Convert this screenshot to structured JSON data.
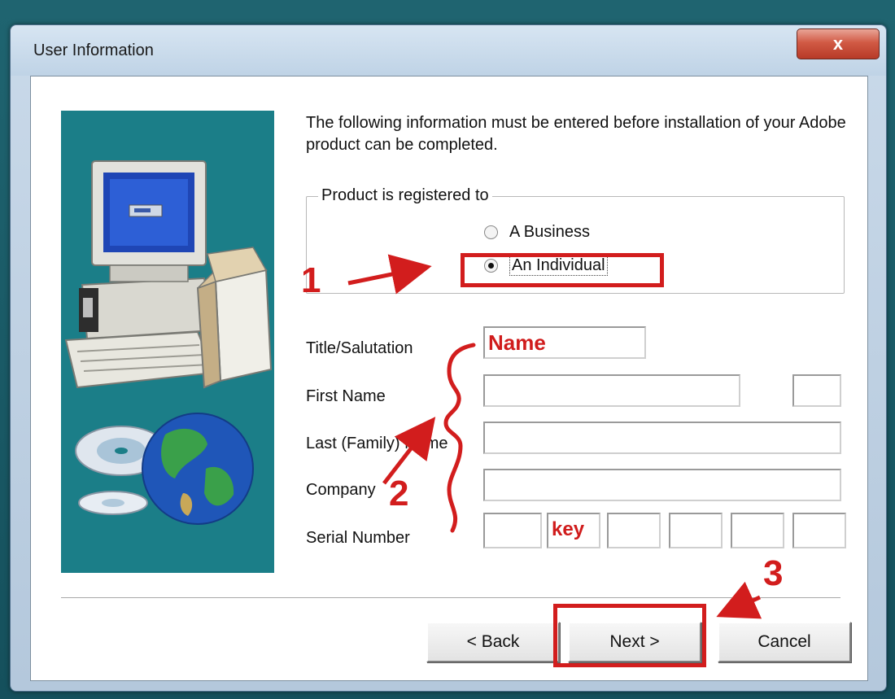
{
  "window": {
    "title": "User Information",
    "close_symbol": "x"
  },
  "intro_text": "The following information must be entered before installation of your Adobe product can be completed.",
  "registration": {
    "legend": "Product is registered to",
    "options": [
      {
        "label": "A Business",
        "selected": false
      },
      {
        "label": "An Individual",
        "selected": true
      }
    ]
  },
  "fields": {
    "title_label": "Title/Salutation",
    "title_value": "Name",
    "first_name_label": "First Name",
    "last_name_label": "Last (Family) Name",
    "company_label": "Company",
    "serial_label": "Serial Number",
    "serial_value": "key"
  },
  "buttons": {
    "back": "< Back",
    "next": "Next >",
    "cancel": "Cancel"
  },
  "annotations": {
    "step1": "1",
    "step2": "2",
    "step3": "3",
    "color": "#d21d1d"
  },
  "icons": [
    "close-icon",
    "computer-icon",
    "box-icon",
    "cd-icon",
    "globe-icon"
  ]
}
